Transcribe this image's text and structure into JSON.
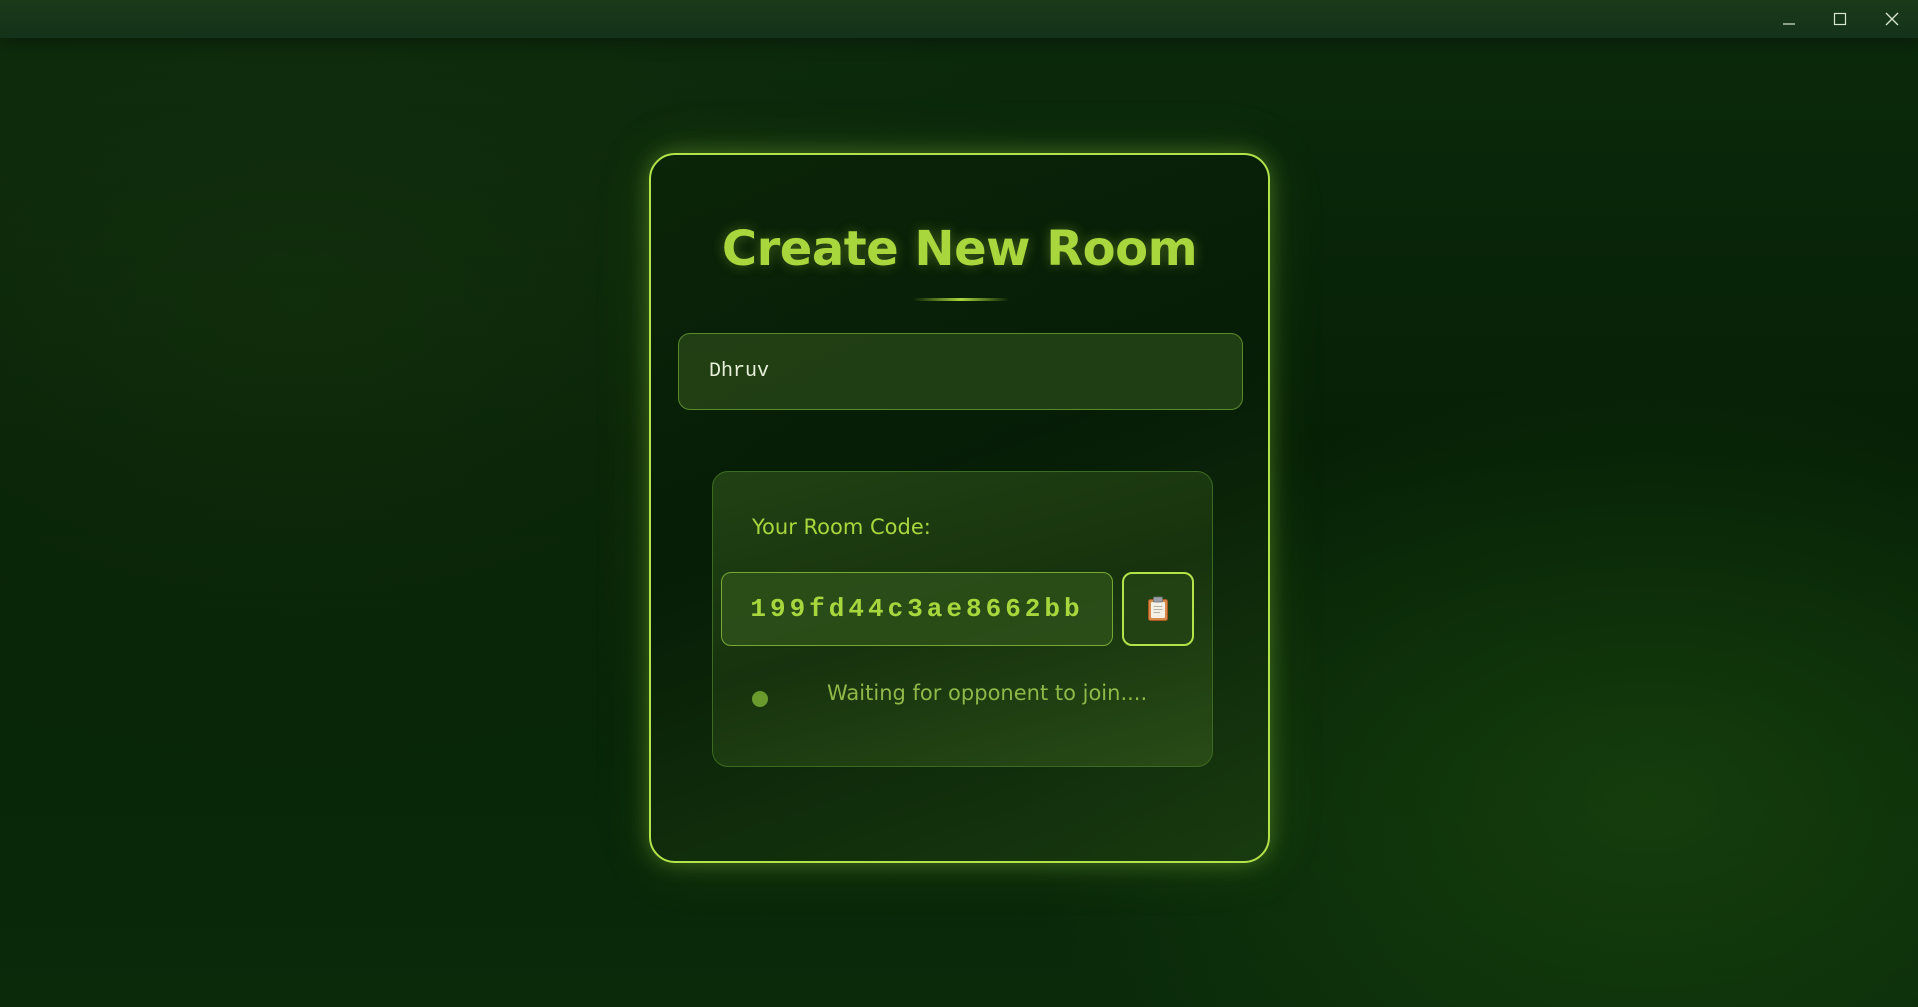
{
  "window": {
    "controls": [
      "minimize-icon",
      "maximize-icon",
      "close-icon"
    ]
  },
  "card": {
    "title": "Create New Room",
    "name_input": {
      "value": "Dhruv"
    },
    "room_code_panel": {
      "label": "Your Room Code:",
      "code": "199fd44c3ae8662bb",
      "copy_icon": "clipboard-icon",
      "status_text": "Waiting for opponent to join...."
    }
  },
  "colors": {
    "accent": "#b3e34a",
    "title_text": "#a8d63d",
    "background": "#062006",
    "status_dot": "#6a9a2e"
  }
}
